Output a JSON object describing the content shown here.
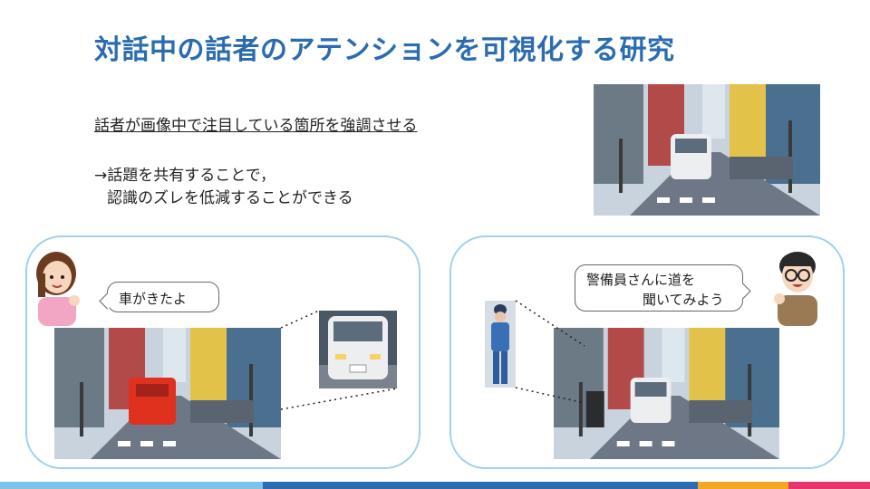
{
  "slide": {
    "title": "対話中の話者のアテンションを可視化する研究",
    "line1": "話者が画像中で注目している箇所を強調させる",
    "line2": "→話題を共有することで，",
    "line3": "認識のズレを低減することができる"
  },
  "left_panel": {
    "speech": "車がきたよ"
  },
  "right_panel": {
    "speech_line1": "警備員さんに道を",
    "speech_line2": "聞いてみよう"
  },
  "colors": {
    "title": "#2b6cb0",
    "panel_border": "#9fd0ee",
    "highlight": "#e0301e",
    "footer": [
      "#7dc3ea",
      "#2b6cb0",
      "#f5a623",
      "#e8336d"
    ]
  }
}
